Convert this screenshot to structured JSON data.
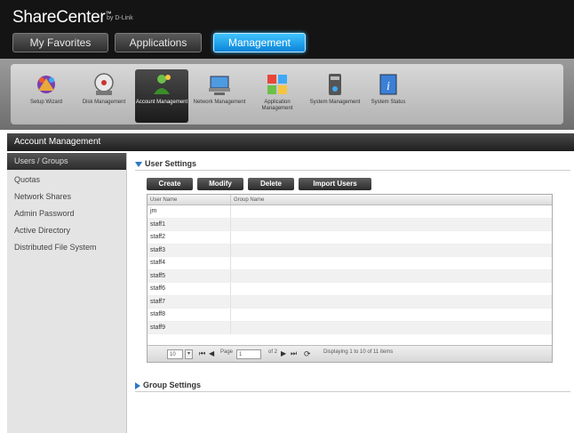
{
  "header": {
    "logo": "ShareCenter",
    "logo_tm": "™",
    "logo_sub": "by D-Link",
    "tabs": [
      {
        "label": "My Favorites"
      },
      {
        "label": "Applications"
      },
      {
        "label": "Management",
        "active": true
      }
    ]
  },
  "toolbar": {
    "items": [
      {
        "label": "Setup Wizard",
        "icon": "wizard-icon"
      },
      {
        "label": "Disk Management",
        "icon": "disk-icon"
      },
      {
        "label": "Account Management",
        "icon": "account-icon",
        "active": true
      },
      {
        "label": "Network Management",
        "icon": "network-icon"
      },
      {
        "label": "Application Management",
        "icon": "application-icon"
      },
      {
        "label": "System Management",
        "icon": "system-icon"
      },
      {
        "label": "System Status",
        "icon": "info-icon"
      }
    ]
  },
  "section_title": "Account Management",
  "sidebar": {
    "items": [
      {
        "label": "Users / Groups",
        "active": true
      },
      {
        "label": "Quotas"
      },
      {
        "label": "Network Shares"
      },
      {
        "label": "Admin Password"
      },
      {
        "label": "Active Directory"
      },
      {
        "label": "Distributed File System"
      }
    ]
  },
  "user_settings": {
    "title": "User Settings",
    "buttons": {
      "create": "Create",
      "modify": "Modify",
      "delete": "Delete",
      "import": "Import Users"
    },
    "columns": [
      "User Name",
      "Group Name"
    ],
    "rows": [
      {
        "user": "jm",
        "group": ""
      },
      {
        "user": "staff1",
        "group": ""
      },
      {
        "user": "staff2",
        "group": ""
      },
      {
        "user": "staff3",
        "group": ""
      },
      {
        "user": "staff4",
        "group": ""
      },
      {
        "user": "staff5",
        "group": ""
      },
      {
        "user": "staff6",
        "group": ""
      },
      {
        "user": "staff7",
        "group": ""
      },
      {
        "user": "staff8",
        "group": ""
      },
      {
        "user": "staff9",
        "group": ""
      }
    ],
    "pager": {
      "page_size": "10",
      "page_label": "Page",
      "page_value": "1",
      "of_label": "of 2",
      "info": "Displaying 1 to 10 of 11 items"
    }
  },
  "group_settings": {
    "title": "Group Settings"
  },
  "colors": {
    "accent": "#1a90e0",
    "header_bg": "#141414"
  }
}
